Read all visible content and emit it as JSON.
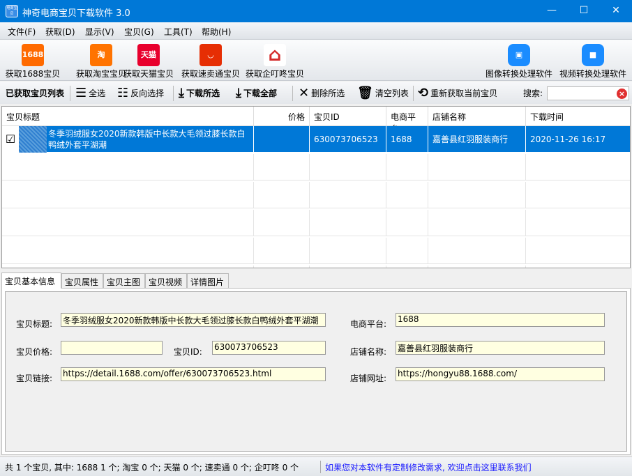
{
  "window": {
    "title": "神奇电商宝贝下载软件 3.0",
    "logo_text": "电商宝贝",
    "minimize": "—",
    "maximize": "☐",
    "close": "✕"
  },
  "menu": [
    "文件(F)",
    "获取(D)",
    "显示(V)",
    "宝贝(G)",
    "工具(T)",
    "帮助(H)"
  ],
  "big_toolbar": [
    {
      "label": "获取1688宝贝",
      "icon": "1688-icon",
      "icon_text": "1688",
      "color": "#ff6a00"
    },
    {
      "label": "获取淘宝宝贝",
      "icon": "taobao-icon",
      "icon_text": "淘",
      "color": "#ff7300"
    },
    {
      "label": "获取天猫宝贝",
      "icon": "tmall-icon",
      "icon_text": "天猫",
      "color": "#e8002d"
    },
    {
      "label": "获取速卖通宝贝",
      "icon": "aliexpress-icon",
      "icon_text": "◡",
      "color": "#e62e04"
    },
    {
      "label": "获取企叮咚宝贝",
      "icon": "qidingdong-icon",
      "icon_text": "⌂",
      "color": "#ffffff"
    },
    {
      "label": "图像转换处理软件",
      "icon": "image-icon",
      "icon_text": "▣",
      "color": "#1a8cff"
    },
    {
      "label": "视频转换处理软件",
      "icon": "video-icon",
      "icon_text": "■",
      "color": "#1a8cff"
    }
  ],
  "small_toolbar": {
    "list_label": "已获取宝贝列表",
    "select_all": "全选",
    "invert": "反向选择",
    "download_selected": "下载所选",
    "download_all": "下载全部",
    "delete_selected": "删除所选",
    "clear_list": "清空列表",
    "refetch": "重新获取当前宝贝",
    "search_label": "搜索:",
    "search_value": ""
  },
  "table": {
    "columns": [
      "宝贝标题",
      "价格",
      "宝贝ID",
      "电商平台",
      "店铺名称",
      "下载时间"
    ],
    "rows": [
      {
        "checked": true,
        "title": "冬季羽绒服女2020新款韩版中长款大毛领过膝长款白鸭绒外套平湖潮",
        "price": "",
        "id": "630073706523",
        "platform": "1688",
        "shop": "嘉善县红羽服装商行",
        "time": "2020-11-26 16:17"
      }
    ]
  },
  "tabs": [
    "宝贝基本信息",
    "宝贝属性",
    "宝贝主图",
    "宝贝视频",
    "详情图片"
  ],
  "form": {
    "title_label": "宝贝标题:",
    "title": "冬季羽绒服女2020新款韩版中长款大毛领过膝长款白鸭绒外套平湖潮",
    "price_label": "宝贝价格:",
    "price": "",
    "id_label": "宝贝ID:",
    "id": "630073706523",
    "link_label": "宝贝链接:",
    "link": "https://detail.1688.com/offer/630073706523.html",
    "platform_label": "电商平台:",
    "platform": "1688",
    "shop_label": "店铺名称:",
    "shop": "嘉善县红羽服装商行",
    "shop_url_label": "店铺网址:",
    "shop_url": "https://hongyu88.1688.com/"
  },
  "status": {
    "summary": "共 1 个宝贝, 其中: 1688 1 个; 淘宝 0 个; 天猫 0 个; 速卖通 0 个; 企叮咚 0 个",
    "contact": "如果您对本软件有定制修改需求, 欢迎点击这里联系我们"
  }
}
